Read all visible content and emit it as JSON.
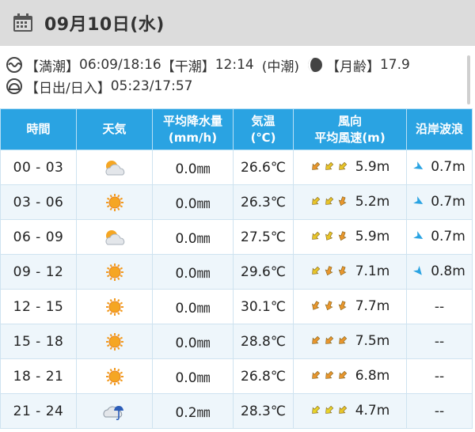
{
  "header": {
    "date": "09月10日(水)",
    "icon": "calendar-icon"
  },
  "info": {
    "tide_full_label": "【満潮】",
    "tide_full_value": "06:09/18:16",
    "tide_low_label": "【干潮】",
    "tide_low_value": "12:14",
    "tide_type": "(中潮)",
    "moon_label": "【月齢】",
    "moon_value": "17.9",
    "sun_label": "【日出/日入】",
    "sun_value": "05:23/17:57"
  },
  "columns": {
    "time": "時間",
    "weather": "天気",
    "rain_1": "平均降水量",
    "rain_2": "(mm/h)",
    "temp_1": "気温",
    "temp_2": "(℃)",
    "wind_1": "風向",
    "wind_2": "平均風速(m)",
    "wave": "沿岸波浪"
  },
  "rows": [
    {
      "time": "00 - 03",
      "weather": "partly-cloudy",
      "rain": "0.0㎜",
      "temp": "26.6℃",
      "wind_dirs": [
        225,
        225,
        225
      ],
      "wind_colors": [
        "#e8962e",
        "#e8c52a",
        "#e8c52a"
      ],
      "wind": "5.9m",
      "wave_dir": 120,
      "wave": "0.7m"
    },
    {
      "time": "03 - 06",
      "weather": "sunny",
      "rain": "0.0㎜",
      "temp": "26.3℃",
      "wind_dirs": [
        225,
        225,
        200
      ],
      "wind_colors": [
        "#e8c52a",
        "#e8c52a",
        "#e8962e"
      ],
      "wind": "5.2m",
      "wave_dir": 120,
      "wave": "0.7m"
    },
    {
      "time": "06 - 09",
      "weather": "partly-cloudy",
      "rain": "0.0㎜",
      "temp": "27.5℃",
      "wind_dirs": [
        225,
        210,
        200
      ],
      "wind_colors": [
        "#e8c52a",
        "#e8c52a",
        "#e8962e"
      ],
      "wind": "5.9m",
      "wave_dir": 120,
      "wave": "0.7m"
    },
    {
      "time": "09 - 12",
      "weather": "sunny",
      "rain": "0.0㎜",
      "temp": "29.6℃",
      "wind_dirs": [
        225,
        200,
        200
      ],
      "wind_colors": [
        "#e8c52a",
        "#e8962e",
        "#e8962e"
      ],
      "wind": "7.1m",
      "wave_dir": 140,
      "wave": "0.8m"
    },
    {
      "time": "12 - 15",
      "weather": "sunny",
      "rain": "0.0㎜",
      "temp": "30.1℃",
      "wind_dirs": [
        210,
        200,
        200
      ],
      "wind_colors": [
        "#e8962e",
        "#e8962e",
        "#e8962e"
      ],
      "wind": "7.7m",
      "wave_dir": null,
      "wave": "--"
    },
    {
      "time": "15 - 18",
      "weather": "sunny",
      "rain": "0.0㎜",
      "temp": "28.8℃",
      "wind_dirs": [
        225,
        225,
        225
      ],
      "wind_colors": [
        "#e8962e",
        "#e8962e",
        "#e8962e"
      ],
      "wind": "7.5m",
      "wave_dir": null,
      "wave": "--"
    },
    {
      "time": "18 - 21",
      "weather": "sunny",
      "rain": "0.0㎜",
      "temp": "26.8℃",
      "wind_dirs": [
        225,
        225,
        225
      ],
      "wind_colors": [
        "#e8962e",
        "#e8962e",
        "#e8962e"
      ],
      "wind": "6.8m",
      "wave_dir": null,
      "wave": "--"
    },
    {
      "time": "21 - 24",
      "weather": "cloudy-rain",
      "rain": "0.2㎜",
      "temp": "28.3℃",
      "wind_dirs": [
        225,
        225,
        225
      ],
      "wind_colors": [
        "#e8d42a",
        "#e8d42a",
        "#e8c52a"
      ],
      "wind": "4.7m",
      "wave_dir": null,
      "wave": "--"
    }
  ],
  "colors": {
    "header_bg": "#2aa3e2",
    "date_bar_bg": "#dcdcdc",
    "row_alt": "#eef6fb",
    "wave_arrow": "#2aa3e2"
  }
}
